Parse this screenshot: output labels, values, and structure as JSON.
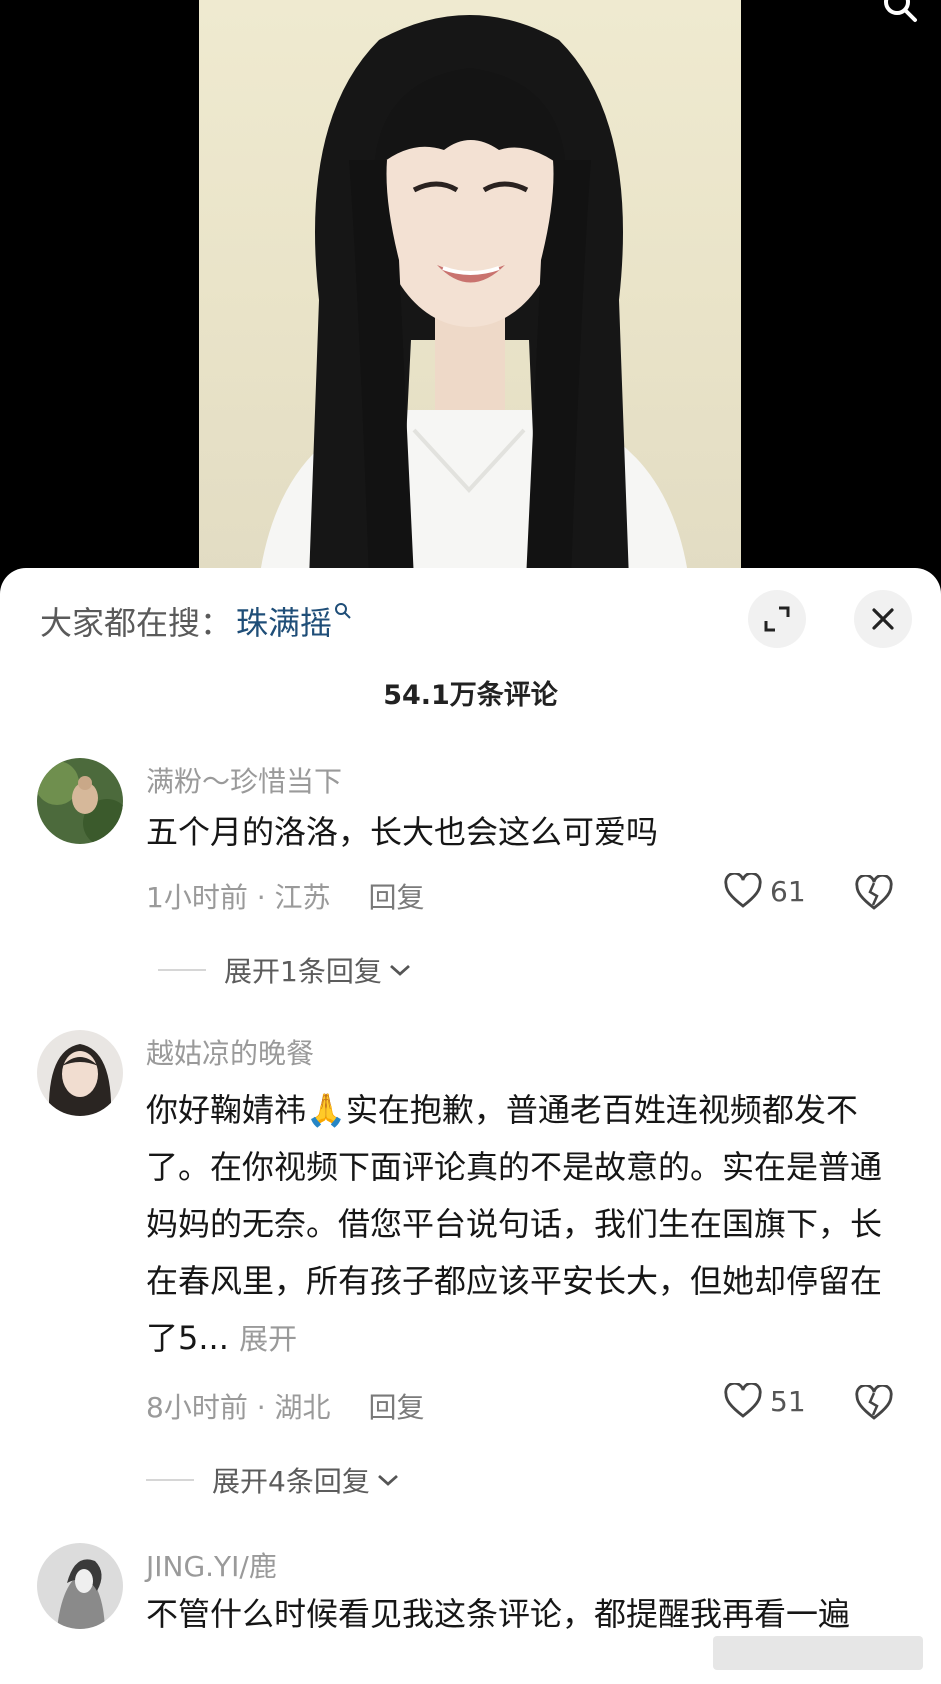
{
  "search": {
    "prefix": "大家都在搜：",
    "keyword": "珠满摇"
  },
  "comment_count": "54.1万条评论",
  "comments": [
    {
      "username": "满粉～珍惜当下",
      "text": "五个月的洛洛，长大也会这么可爱吗",
      "time_location": "1小时前 · 江苏",
      "reply_label": "回复",
      "likes": "61",
      "replies_label": "展开1条回复"
    },
    {
      "username": "越姑凉的晚餐",
      "text": "你好鞠婧祎",
      "emoji": "🙏",
      "text_rest": "实在抱歉，普通老百姓连视频都发不了。在你视频下面评论真的不是故意的。实在是普通妈妈的无奈。借您平台说句话，我们生在国旗下，长在春风里，所有孩子都应该平安长大，但她却停留在了5...",
      "expand_label": "展开",
      "time_location": "8小时前 · 湖北",
      "reply_label": "回复",
      "likes": "51",
      "replies_label": "展开4条回复"
    },
    {
      "username": "JING.YI/鹿",
      "text": "不管什么时候看见我这条评论，都提醒我再看一遍"
    }
  ],
  "icons": {
    "search": "search-icon",
    "expand": "expand-icon",
    "close": "close-icon",
    "like": "heart-icon",
    "dislike": "broken-heart-icon",
    "chevron": "chevron-down-icon"
  },
  "colors": {
    "keyword": "#1f4e78",
    "muted": "#9a9a9a",
    "text": "#161616"
  }
}
